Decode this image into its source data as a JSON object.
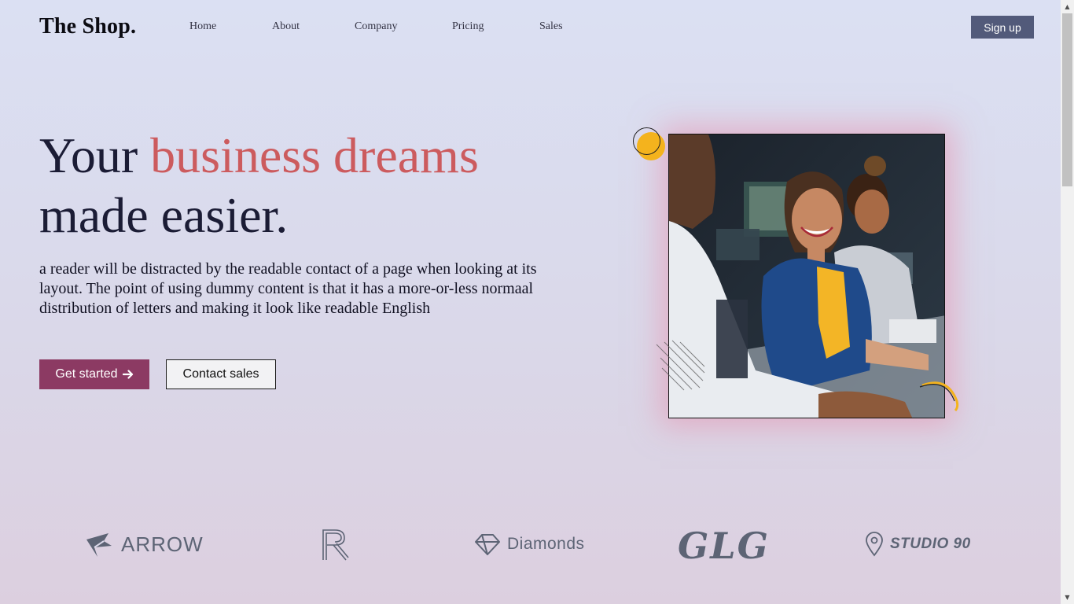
{
  "header": {
    "logo": "The Shop.",
    "nav": [
      {
        "label": "Home"
      },
      {
        "label": "About"
      },
      {
        "label": "Company"
      },
      {
        "label": "Pricing"
      },
      {
        "label": "Sales"
      }
    ],
    "signup_label": "Sign up"
  },
  "hero": {
    "headline_start": "Your ",
    "headline_accent": "business dreams",
    "headline_end": "made easier.",
    "description": "a reader will be distracted by the readable contact of a page when looking at its layout. The point of using dummy content is that it has a more-or-less normaal distribution of letters and making it look like readable English",
    "primary_button": "Get started",
    "secondary_button": "Contact sales"
  },
  "brands": [
    {
      "name": "ARROW",
      "icon": "arrow-logo-icon"
    },
    {
      "name": "",
      "icon": "r-monogram-logo-icon"
    },
    {
      "name": "Diamonds",
      "icon": "diamond-logo-icon"
    },
    {
      "name": "GLG",
      "icon": "glg-blackletter-logo"
    },
    {
      "name": "STUDIO 90",
      "icon": "map-pin-logo-icon"
    }
  ],
  "colors": {
    "accent": "#cc5b5e",
    "primary_button": "#8c3a63",
    "signup_button": "#525a7a",
    "decor_yellow": "#f4b31d"
  }
}
